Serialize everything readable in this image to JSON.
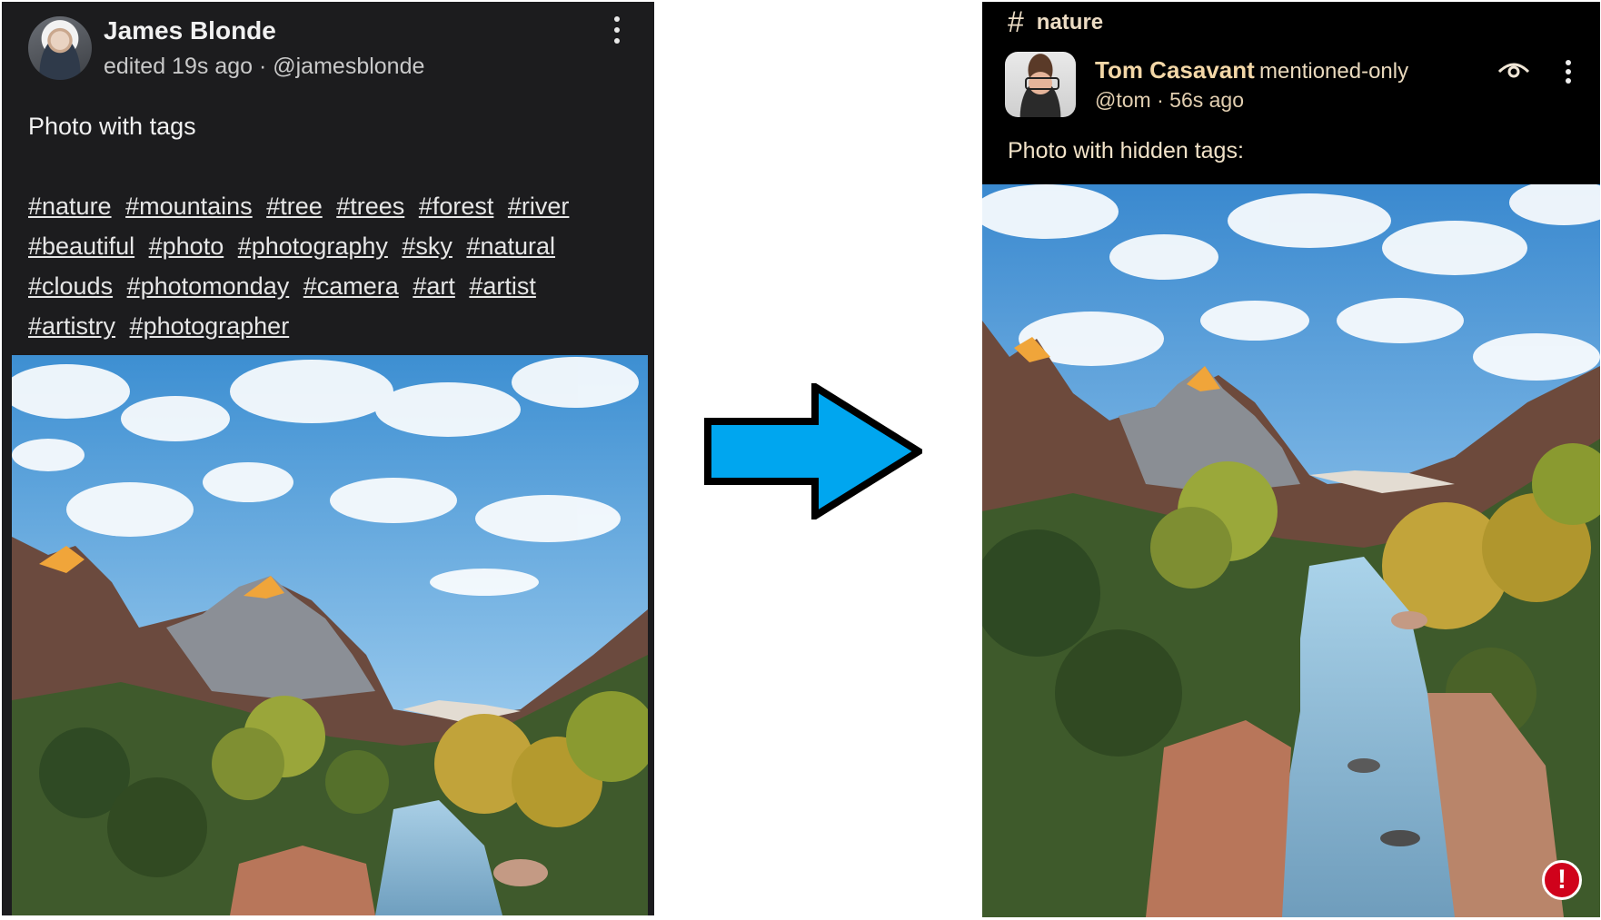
{
  "left_post": {
    "author_name": "James Blonde",
    "edited": "edited 19s ago",
    "separator": " · ",
    "handle": "@jamesblonde",
    "text": "Photo with tags",
    "tags": [
      "#nature",
      "#mountains",
      "#tree",
      "#trees",
      "#forest",
      "#river",
      "#beautiful",
      "#photo",
      "#photography",
      "#sky",
      "#natural",
      "#clouds",
      "#photomonday",
      "#camera",
      "#art",
      "#artist",
      "#artistry",
      "#photographer"
    ]
  },
  "right_post": {
    "channel": "nature",
    "author_name": "Tom Casavant",
    "visibility": "mentioned-only",
    "handle": "@tom",
    "separator": " · ",
    "time": "56s ago",
    "text": "Photo with hidden tags:",
    "alert_glyph": "!"
  },
  "colors": {
    "arrow_fill": "#00a6ef",
    "left_bg": "#1c1c1e",
    "right_bg": "#000000",
    "right_accent": "#f3d7a7",
    "alert": "#d0021b"
  }
}
